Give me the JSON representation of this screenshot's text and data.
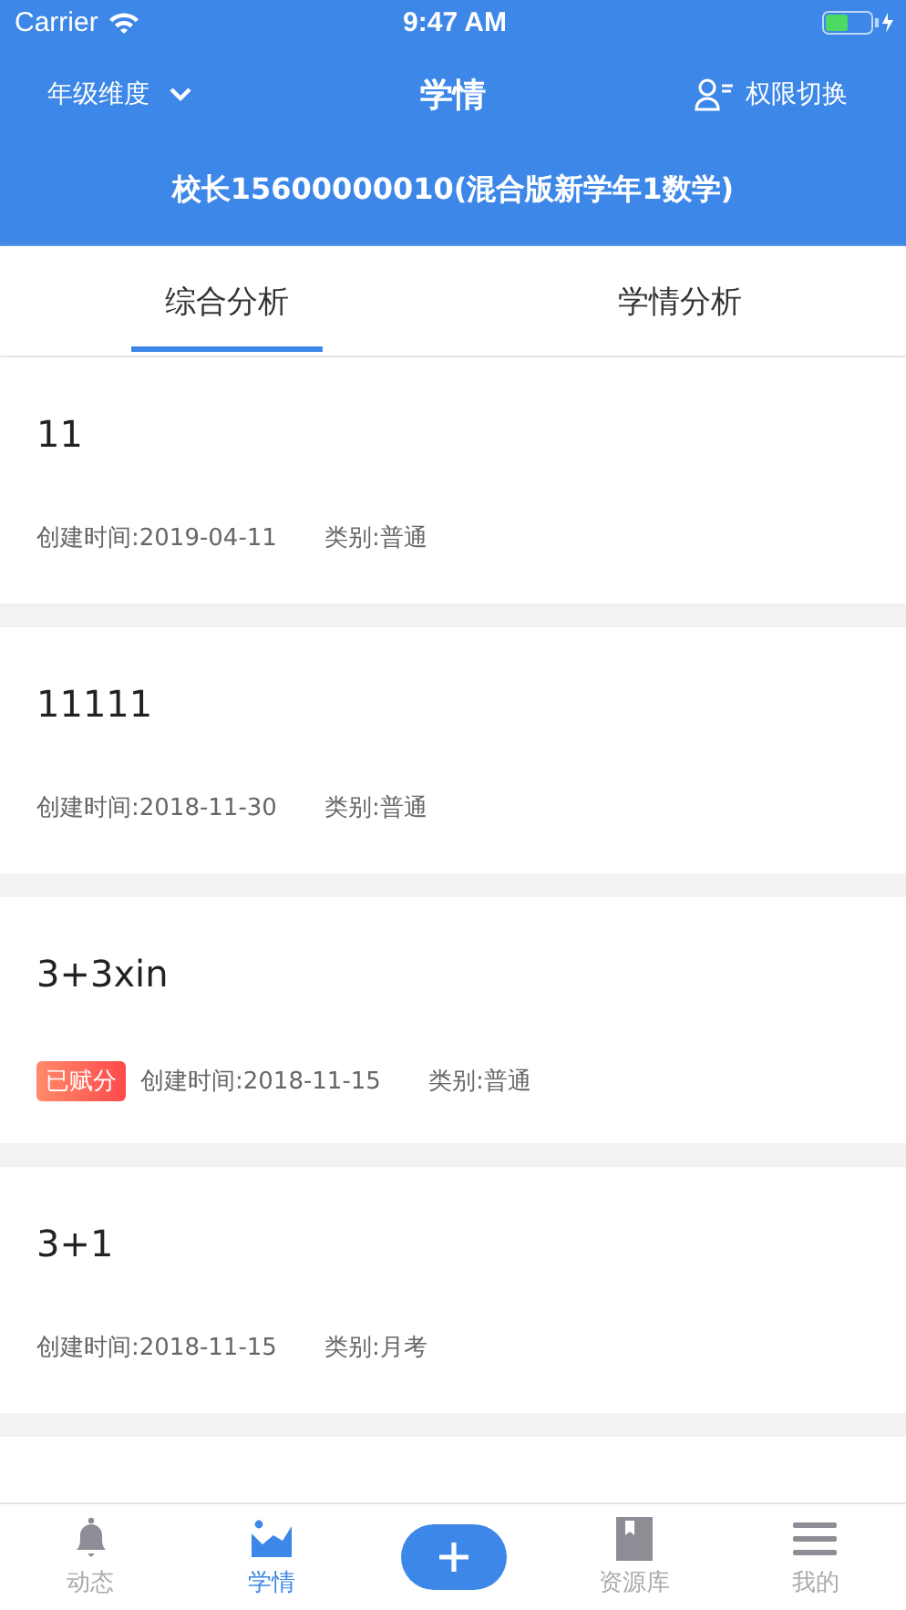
{
  "status_bar": {
    "carrier": "Carrier",
    "time": "9:47 AM"
  },
  "nav": {
    "left": "年级维度",
    "title": "学情",
    "right": "权限切换"
  },
  "subtitle": "校长15600000010(混合版新学年1数学)",
  "tabs": [
    {
      "label": "综合分析",
      "selected": true
    },
    {
      "label": "学情分析",
      "selected": false
    }
  ],
  "cards": [
    {
      "title": "11",
      "created": "创建时间:2019-04-11",
      "category": "类别:普通"
    },
    {
      "title": "11111",
      "created": "创建时间:2018-11-30",
      "category": "类别:普通"
    },
    {
      "title": "3+3xin",
      "badge": "已赋分",
      "created": "创建时间:2018-11-15",
      "category": "类别:普通"
    },
    {
      "title": "3+1",
      "created": "创建时间:2018-11-15",
      "category": "类别:月考"
    }
  ],
  "tab_bar": [
    {
      "kind": "bell",
      "label": "动态",
      "selected": false
    },
    {
      "kind": "chart",
      "label": "学情",
      "selected": true
    },
    {
      "kind": "plus"
    },
    {
      "kind": "book",
      "label": "资源库",
      "selected": false
    },
    {
      "kind": "menu",
      "label": "我的",
      "selected": false
    }
  ]
}
